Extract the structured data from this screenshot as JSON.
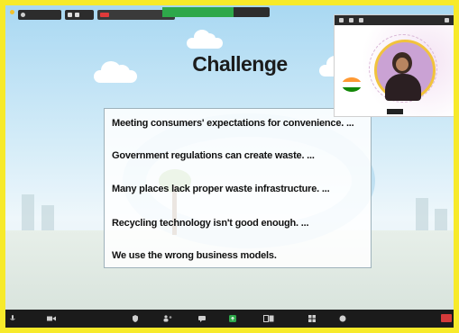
{
  "slide": {
    "title": "Challenge",
    "points": [
      "Meeting consumers' expectations for convenience. ...",
      "Government regulations can create waste. ...",
      "Many places lack proper waste infrastructure. ...",
      "Recycling technology isn't good enough. ...",
      "We use the wrong business models."
    ]
  },
  "colors": {
    "frame_border": "#f7ea2a",
    "share_banner": "#2ea84a",
    "end_button": "#d43a3a"
  },
  "icons": [
    "microphone-icon",
    "video-camera-icon",
    "security-icon",
    "participants-icon",
    "chat-icon",
    "share-screen-icon",
    "record-icon",
    "reactions-icon",
    "apps-icon",
    "end-meeting-icon"
  ]
}
